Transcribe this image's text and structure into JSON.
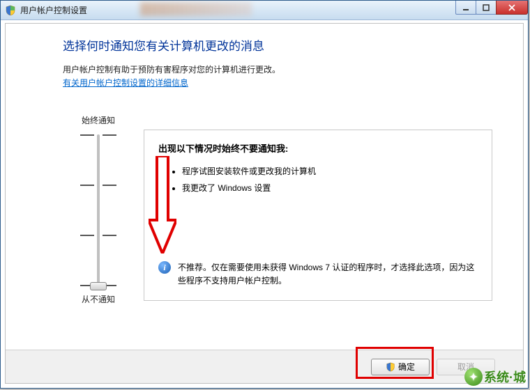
{
  "window": {
    "title": "用户帐户控制设置"
  },
  "heading": "选择何时通知您有关计算机更改的消息",
  "description": "用户帐户控制有助于预防有害程序对您的计算机进行更改。",
  "link_text": "有关用户帐户控制设置的详细信息",
  "slider": {
    "top_label": "始终通知",
    "bottom_label": "从不通知"
  },
  "panel": {
    "heading": "出现以下情况时始终不要通知我:",
    "bullets": [
      "程序试图安装软件或更改我的计算机",
      "我更改了 Windows 设置"
    ],
    "info": "不推荐。仅在需要使用未获得 Windows 7 认证的程序时，才选择此选项，因为这些程序不支持用户帐户控制。"
  },
  "buttons": {
    "ok": "确定",
    "cancel": "取消"
  },
  "watermark": "系统·城",
  "colors": {
    "heading": "#003399",
    "link": "#0066cc",
    "annotation": "#e00000"
  }
}
